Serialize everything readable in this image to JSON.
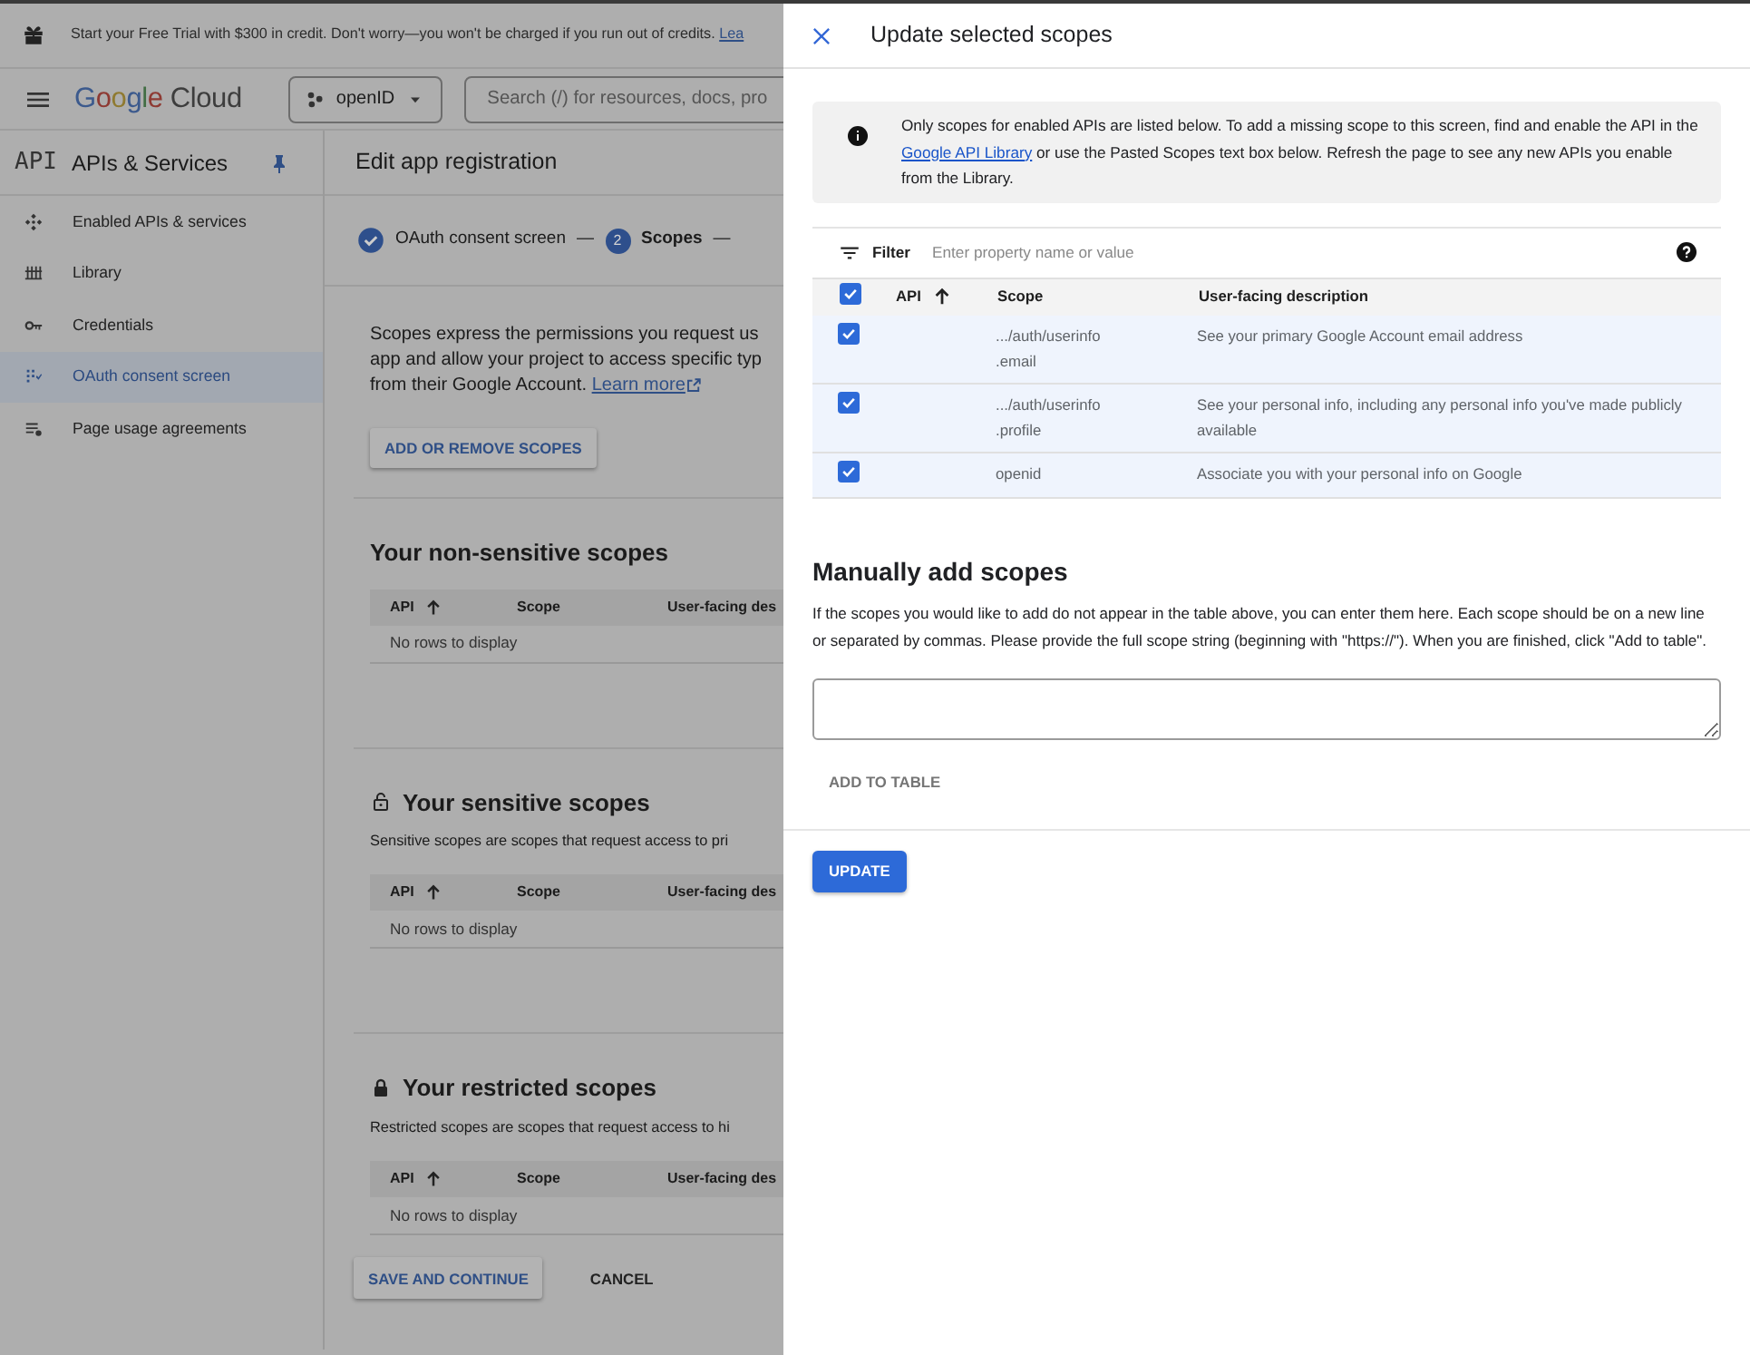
{
  "banner": {
    "text": "Start your Free Trial with $300 in credit. Don't worry—you won't be charged if you run out of credits.",
    "link": "Lea"
  },
  "header": {
    "logo_first": "Google",
    "logo_second": "Cloud",
    "project": "openID",
    "search_placeholder": "Search (/) for resources, docs, pro"
  },
  "sidebar": {
    "badge": "API",
    "title": "APIs & Services",
    "items": [
      {
        "label": "Enabled APIs & services",
        "selected": false
      },
      {
        "label": "Library",
        "selected": false
      },
      {
        "label": "Credentials",
        "selected": false
      },
      {
        "label": "OAuth consent screen",
        "selected": true
      },
      {
        "label": "Page usage agreements",
        "selected": false
      }
    ]
  },
  "page": {
    "title": "Edit app registration",
    "steps": [
      {
        "label": "OAuth consent screen",
        "kind": "done",
        "separator": "—"
      },
      {
        "label": "Scopes",
        "kind": "current",
        "number": "2",
        "separator": "—"
      }
    ],
    "intro": {
      "text": "Scopes express the permissions you request us\napp and allow your project to access specific typ\nfrom their Google Account.",
      "link": "Learn more"
    },
    "add_button": "ADD OR REMOVE SCOPES",
    "sections": [
      {
        "title": "Your non-sensitive scopes",
        "kind": "plain",
        "columns": [
          "API",
          "Scope",
          "User-facing des"
        ],
        "empty": "No rows to display"
      },
      {
        "title": "Your sensitive scopes",
        "kind": "sensitive",
        "description": "Sensitive scopes are scopes that request access to pri",
        "columns": [
          "API",
          "Scope",
          "User-facing des"
        ],
        "empty": "No rows to display"
      },
      {
        "title": "Your restricted scopes",
        "kind": "restricted",
        "description": "Restricted scopes are scopes that request access to hi",
        "columns": [
          "API",
          "Scope",
          "User-facing des"
        ],
        "empty": "No rows to display"
      }
    ],
    "actions": [
      {
        "label": "SAVE AND CONTINUE",
        "kind": "raised"
      },
      {
        "label": "CANCEL",
        "kind": "text"
      }
    ]
  },
  "panel": {
    "title": "Update selected scopes",
    "notice": {
      "before": "Only scopes for enabled APIs are listed below. To add a missing scope to this screen, find and enable the API in the",
      "link": "Google API Library",
      "after": "or use the Pasted Scopes text box below. Refresh the page to see any new APIs you enable from the Library."
    },
    "filter": {
      "label": "Filter",
      "placeholder": "Enter property name or value"
    },
    "table": {
      "all_checked": true,
      "columns": [
        "API",
        "Scope",
        "User-facing description"
      ],
      "rows": [
        {
          "scope": ".../auth/userinfo\n.email",
          "description": "See your primary Google Account email address",
          "checked": true
        },
        {
          "scope": ".../auth/userinfo\n.profile",
          "description": "See your personal info, including any personal info you've made publicly available",
          "checked": true
        },
        {
          "scope": "openid",
          "description": "Associate you with your personal info on Google",
          "checked": true
        }
      ]
    },
    "manual": {
      "title": "Manually add scopes",
      "text": "If the scopes you would like to add do not appear in the table above, you can enter them here. Each scope should be on a new line or separated by commas. Please provide the full scope string (beginning with \"https://\"). When you are finished, click \"Add to table\".",
      "add_button": "ADD TO TABLE"
    },
    "update_button": "UPDATE"
  }
}
